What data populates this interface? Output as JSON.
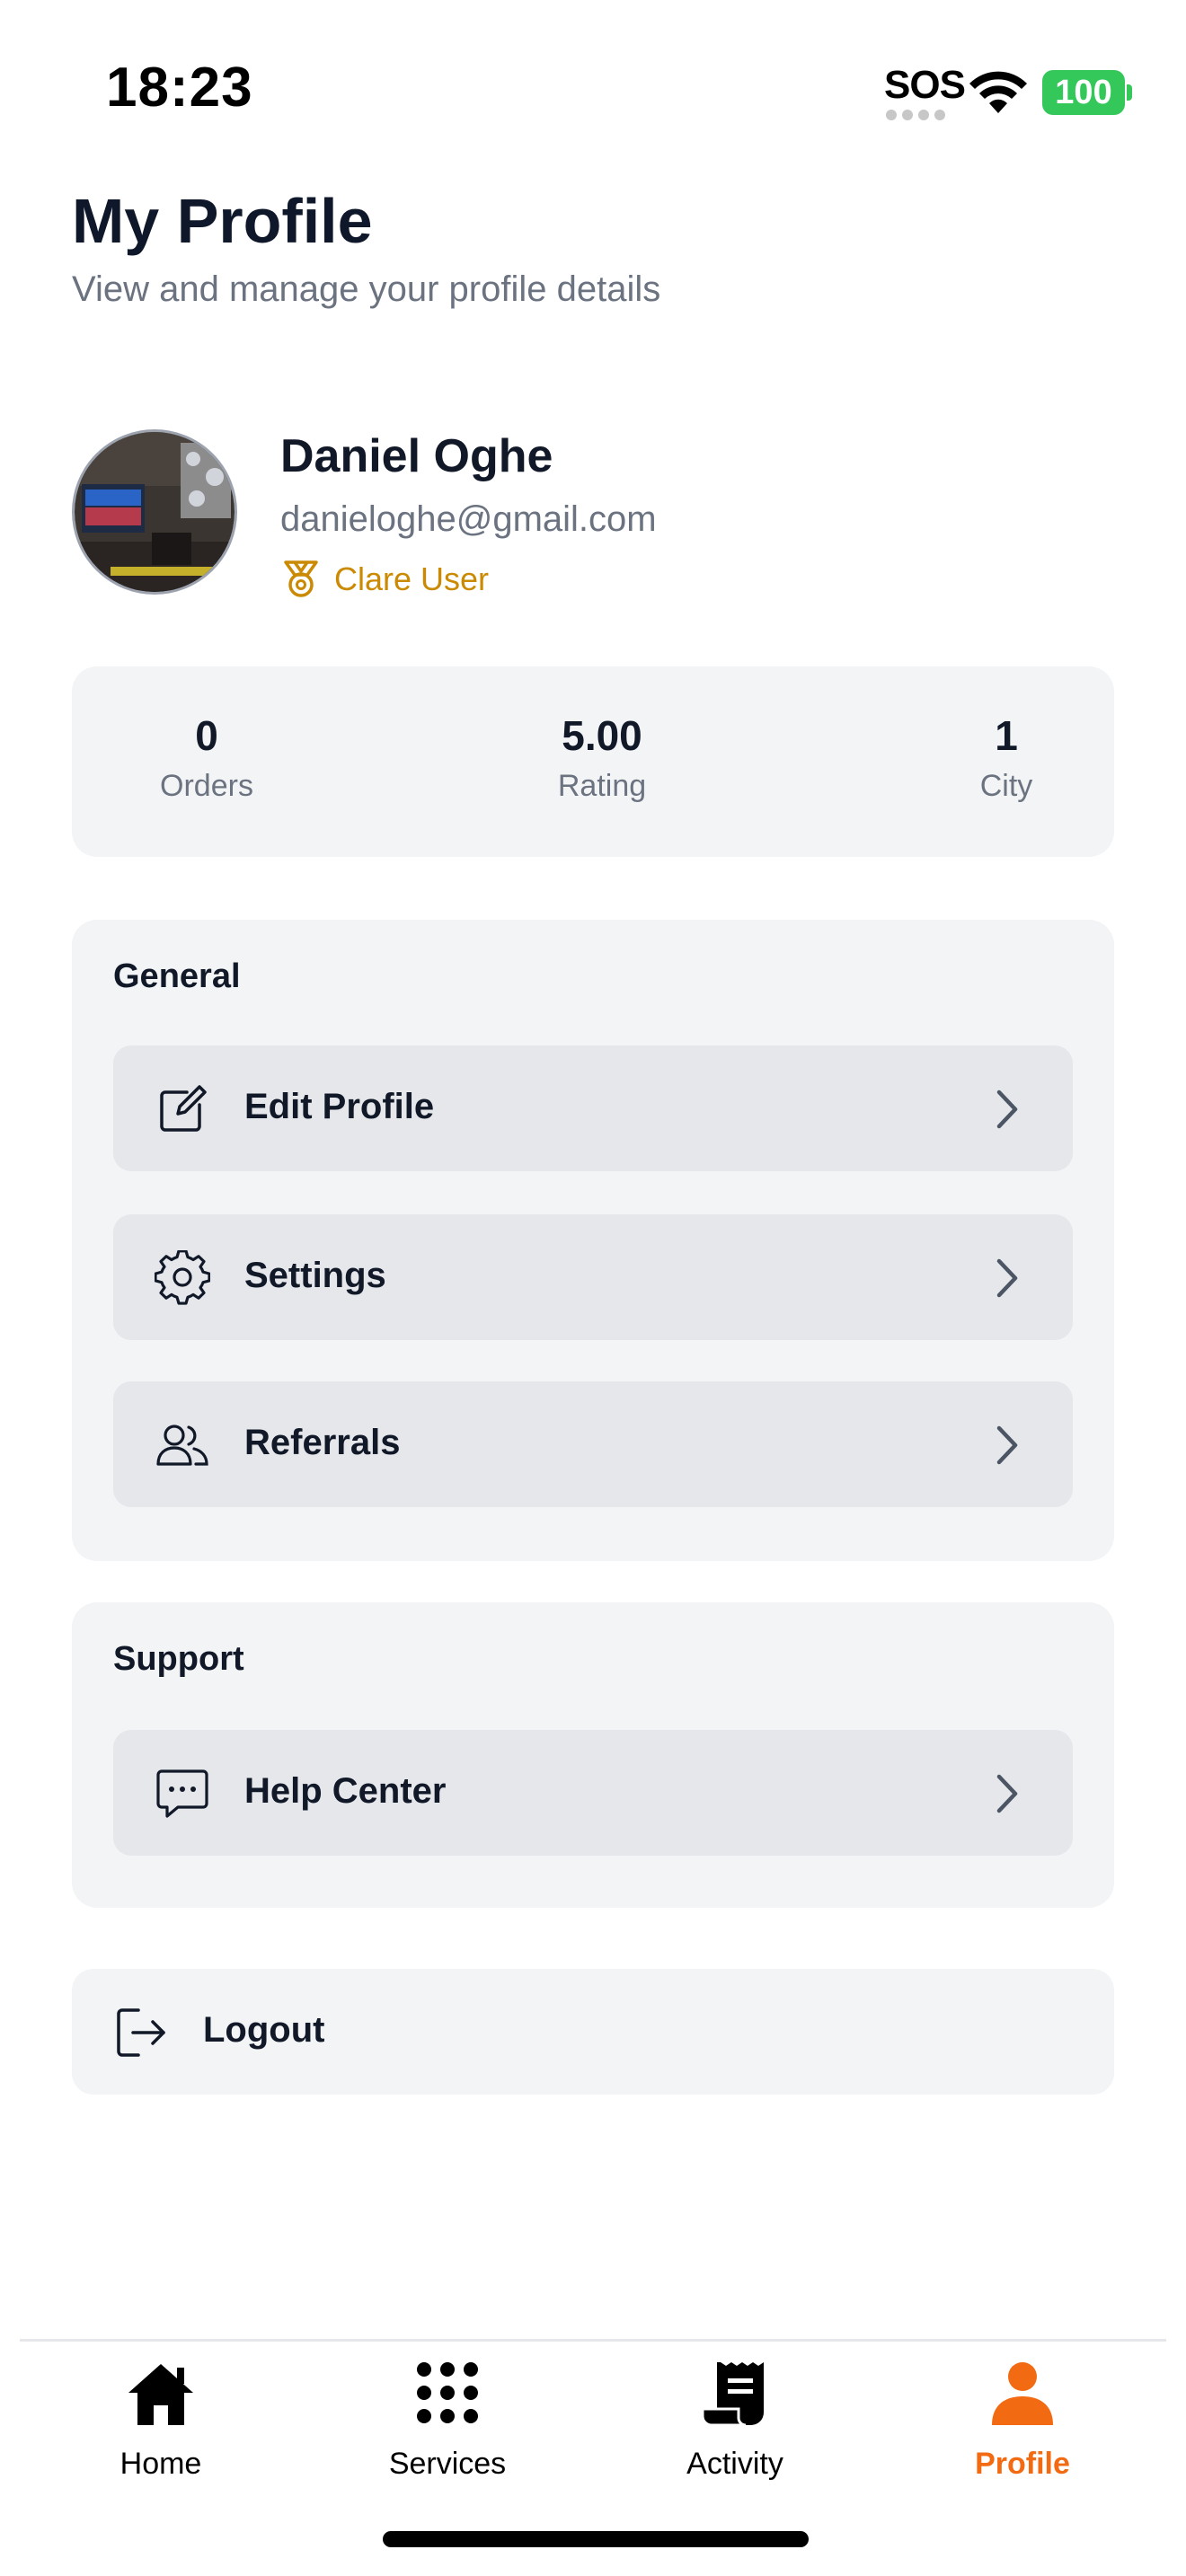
{
  "status_bar": {
    "time": "18:23",
    "sos": "SOS",
    "battery": "100"
  },
  "header": {
    "title": "My Profile",
    "subtitle": "View and manage your profile details"
  },
  "profile": {
    "name": "Daniel Oghe",
    "email": "danieloghe@gmail.com",
    "role": "Clare User"
  },
  "stats": [
    {
      "value": "0",
      "label": "Orders"
    },
    {
      "value": "5.00",
      "label": "Rating"
    },
    {
      "value": "1",
      "label": "City"
    }
  ],
  "general": {
    "title": "General",
    "items": [
      {
        "label": "Edit Profile",
        "icon": "edit-icon"
      },
      {
        "label": "Settings",
        "icon": "gear-icon"
      },
      {
        "label": "Referrals",
        "icon": "users-icon"
      }
    ]
  },
  "support": {
    "title": "Support",
    "items": [
      {
        "label": "Help Center",
        "icon": "chat-icon"
      }
    ]
  },
  "logout": {
    "label": "Logout",
    "icon": "logout-icon"
  },
  "tabs": [
    {
      "label": "Home",
      "icon": "home-icon",
      "active": false
    },
    {
      "label": "Services",
      "icon": "grid-icon",
      "active": false
    },
    {
      "label": "Activity",
      "icon": "receipt-icon",
      "active": false
    },
    {
      "label": "Profile",
      "icon": "person-icon",
      "active": true
    }
  ],
  "colors": {
    "accent": "#f26a12",
    "role": "#ca8a04",
    "card": "#f3f4f6",
    "row": "#e5e7eb",
    "battery": "#34c759"
  }
}
